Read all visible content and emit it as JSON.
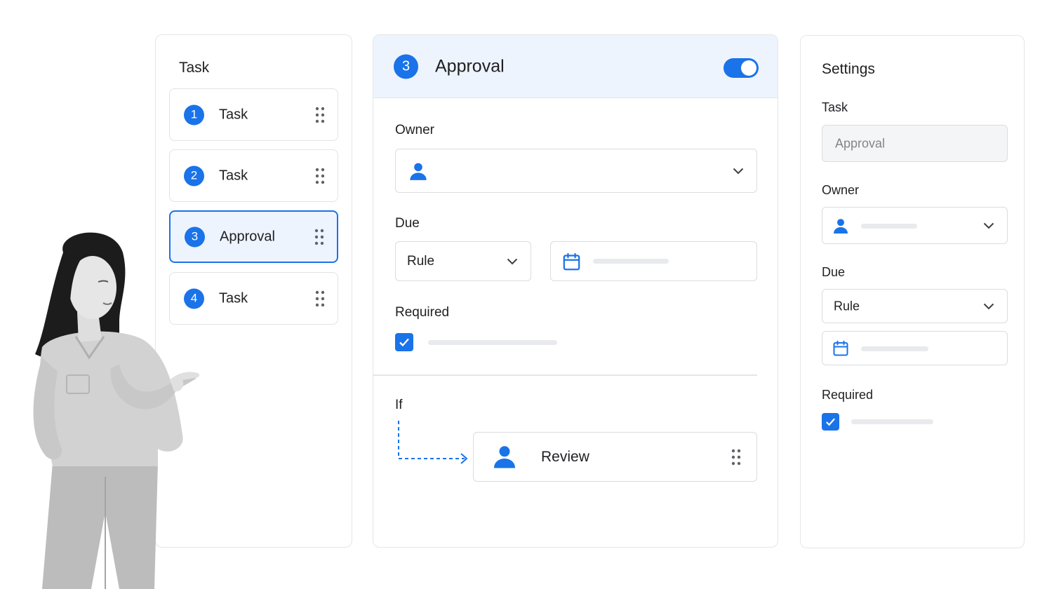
{
  "colors": {
    "accent": "#1a73e8",
    "active_bg": "#eef4fd",
    "border": "#dadce0"
  },
  "task_list": {
    "title": "Task",
    "items": [
      {
        "number": "1",
        "label": "Task"
      },
      {
        "number": "2",
        "label": "Task"
      },
      {
        "number": "3",
        "label": "Approval",
        "active": true
      },
      {
        "number": "4",
        "label": "Task"
      }
    ]
  },
  "editor": {
    "step_number": "3",
    "title": "Approval",
    "enabled": true,
    "owner_label": "Owner",
    "owner_icon": "person-icon",
    "due_label": "Due",
    "due_rule_value": "Rule",
    "date_icon": "calendar-icon",
    "required_label": "Required",
    "required_checked": true,
    "if_label": "If",
    "branch_target": "Review"
  },
  "settings": {
    "title": "Settings",
    "task_label": "Task",
    "task_value": "Approval",
    "owner_label": "Owner",
    "due_label": "Due",
    "due_rule_value": "Rule",
    "required_label": "Required",
    "required_checked": true
  }
}
